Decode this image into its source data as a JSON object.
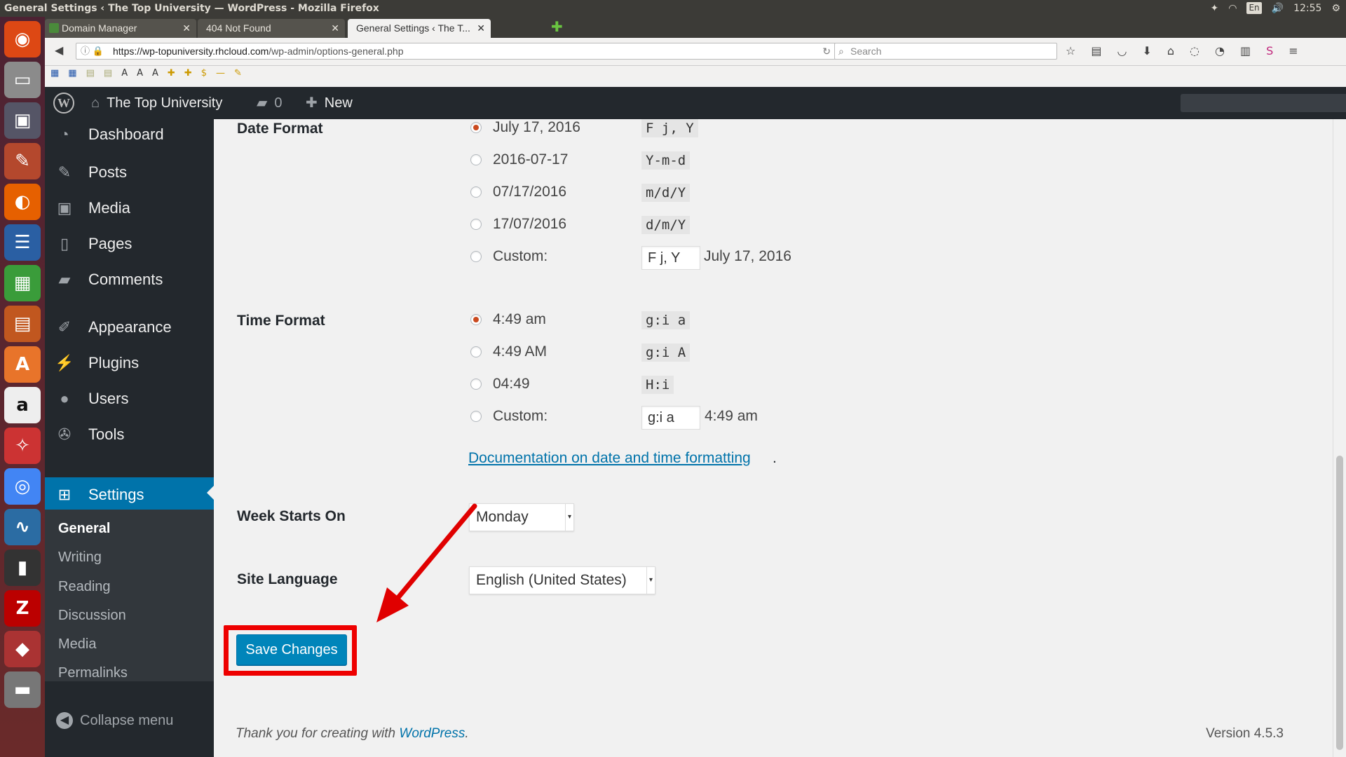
{
  "os": {
    "window_title": "General Settings ‹ The Top University — WordPress - Mozilla Firefox",
    "tray": {
      "lang": "En",
      "time": "12:55"
    }
  },
  "browser": {
    "tabs": [
      {
        "label": "Domain Manager"
      },
      {
        "label": "404 Not Found"
      },
      {
        "label": "General Settings ‹ The T..."
      }
    ],
    "url_host": "https://wp-topuniversity.rhcloud.com",
    "url_path": "/wp-admin/options-general.php",
    "search_placeholder": "Search"
  },
  "adminbar": {
    "site_name": "The Top University",
    "comments_count": "0",
    "new_label": "New"
  },
  "sidebar": {
    "items": [
      {
        "label": "Dashboard",
        "icon": "dashboard-icon"
      },
      {
        "label": "Posts",
        "icon": "pushpin-icon"
      },
      {
        "label": "Media",
        "icon": "media-icon"
      },
      {
        "label": "Pages",
        "icon": "pages-icon"
      },
      {
        "label": "Comments",
        "icon": "comment-icon"
      },
      {
        "label": "Appearance",
        "icon": "brush-icon"
      },
      {
        "label": "Plugins",
        "icon": "plug-icon"
      },
      {
        "label": "Users",
        "icon": "user-icon"
      },
      {
        "label": "Tools",
        "icon": "wrench-icon"
      },
      {
        "label": "Settings",
        "icon": "settings-icon"
      }
    ],
    "submenu": [
      "General",
      "Writing",
      "Reading",
      "Discussion",
      "Media",
      "Permalinks"
    ],
    "collapse_label": "Collapse menu"
  },
  "settings": {
    "date_format": {
      "label": "Date Format",
      "options": [
        {
          "text": "July 17, 2016",
          "code": "F j, Y",
          "checked": true
        },
        {
          "text": "2016-07-17",
          "code": "Y-m-d",
          "checked": false
        },
        {
          "text": "07/17/2016",
          "code": "m/d/Y",
          "checked": false
        },
        {
          "text": "17/07/2016",
          "code": "d/m/Y",
          "checked": false
        }
      ],
      "custom_label": "Custom:",
      "custom_value": "F j, Y",
      "custom_preview": "July 17, 2016"
    },
    "time_format": {
      "label": "Time Format",
      "options": [
        {
          "text": "4:49 am",
          "code": "g:i a",
          "checked": true
        },
        {
          "text": "4:49 AM",
          "code": "g:i A",
          "checked": false
        },
        {
          "text": "04:49",
          "code": "H:i",
          "checked": false
        }
      ],
      "custom_label": "Custom:",
      "custom_value": "g:i a",
      "custom_preview": "4:49 am"
    },
    "doc_link": "Documentation on date and time formatting",
    "week_starts_on": {
      "label": "Week Starts On",
      "value": "Monday"
    },
    "site_language": {
      "label": "Site Language",
      "value": "English (United States)"
    },
    "save_label": "Save Changes"
  },
  "footer": {
    "thanks_prefix": "Thank you for creating with ",
    "thanks_link": "WordPress",
    "version": "Version 4.5.3"
  },
  "colors": {
    "accent": "#0073aa",
    "annotation": "#e00000",
    "radio_checked": "#ca4a1f"
  }
}
